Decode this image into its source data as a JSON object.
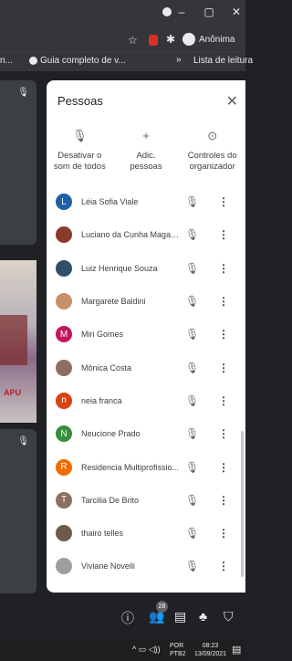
{
  "browser": {
    "anon_label": "Anônima",
    "bookmarks": [
      "n...",
      "Guia completo de v...",
      "»",
      "Lista de leitura"
    ]
  },
  "panel": {
    "title": "Pessoas",
    "close": "✕",
    "actions": [
      {
        "icon": "mic-off-icon",
        "glyph": "🎙",
        "line1": "Desativar o",
        "line2": "som de todos"
      },
      {
        "icon": "add-person-icon",
        "glyph": "+",
        "line1": "Adic.",
        "line2": "pessoas"
      },
      {
        "icon": "host-controls-icon",
        "glyph": "⊙",
        "line1": "Controles do",
        "line2": "organizador"
      }
    ],
    "participants": [
      {
        "name": "Léia Sofia Viale",
        "initial": "L",
        "color": "#1e5fa8"
      },
      {
        "name": "Luciano da Cunha Magalh...",
        "initial": "",
        "color": "#8a3a2a"
      },
      {
        "name": "Luiz Henrique Souza",
        "initial": "",
        "color": "#2f4f6a"
      },
      {
        "name": "Margarete Baldini",
        "initial": "",
        "color": "#c8906a"
      },
      {
        "name": "Miri Gomes",
        "initial": "M",
        "color": "#c2185b"
      },
      {
        "name": "Mônica Costa",
        "initial": "",
        "color": "#8d6e63"
      },
      {
        "name": "neia franca",
        "initial": "n",
        "color": "#d84315"
      },
      {
        "name": "Neucione Prado",
        "initial": "N",
        "color": "#388e3c"
      },
      {
        "name": "Residencia Multiprofissio...",
        "initial": "R",
        "color": "#ef6c00"
      },
      {
        "name": "Tarcilia De Brito",
        "initial": "T",
        "color": "#8d6e63"
      },
      {
        "name": "thairo telles",
        "initial": "",
        "color": "#6d5a4a"
      },
      {
        "name": "Viviane Novelli",
        "initial": "",
        "color": "#9e9e9e"
      }
    ]
  },
  "bottom": {
    "people_count": "28"
  },
  "taskbar": {
    "lang1": "POR",
    "lang2": "PTB2",
    "time": "08:23",
    "date": "13/09/2021"
  }
}
